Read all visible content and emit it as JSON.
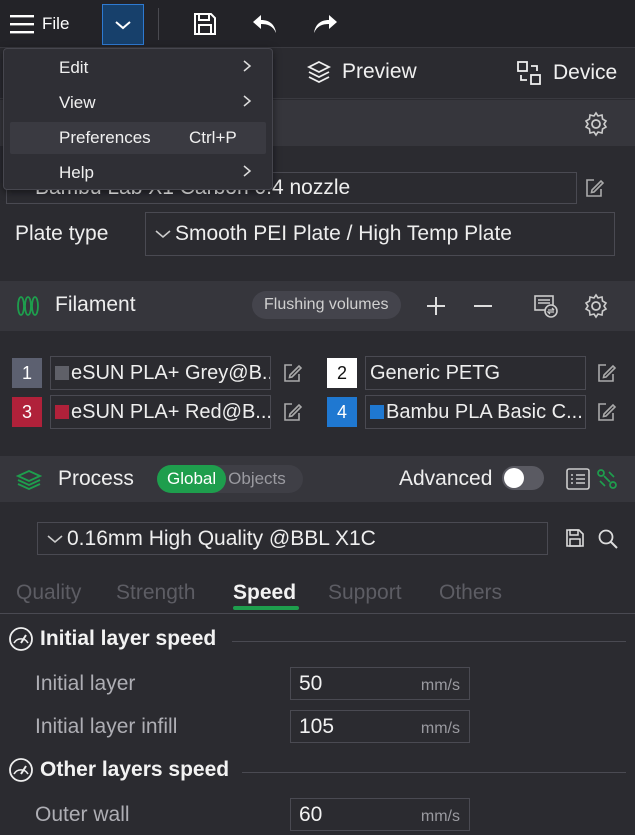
{
  "toolbar": {
    "file_label": "File",
    "icons": [
      "menu-icon",
      "chevron-down-icon",
      "save-icon",
      "undo-icon",
      "redo-icon"
    ]
  },
  "tabs": [
    {
      "label": "Preview",
      "icon": "cube-layers-icon"
    },
    {
      "label": "Device",
      "icon": "device-icon"
    }
  ],
  "menu": {
    "items": [
      {
        "label": "Edit",
        "shortcut": "",
        "has_submenu": true
      },
      {
        "label": "View",
        "shortcut": "",
        "has_submenu": true
      },
      {
        "label": "Preferences",
        "shortcut": "Ctrl+P",
        "has_submenu": false,
        "highlighted": true
      },
      {
        "label": "Help",
        "shortcut": "",
        "has_submenu": true
      }
    ]
  },
  "printer": {
    "selected": "Bambu Lab X1 Carbon 0.4 nozzle",
    "plate_type_label": "Plate type",
    "plate_type_value": "Smooth PEI Plate / High Temp Plate"
  },
  "filament": {
    "title": "Filament",
    "flushing_label": "Flushing volumes",
    "slots": [
      {
        "num": "1",
        "name": "eSUN PLA+ Grey@B...",
        "badge_color": "#5c6070",
        "swatch": "#5f6068"
      },
      {
        "num": "2",
        "name": "Generic PETG",
        "badge_color": "#ffffff",
        "swatch": ""
      },
      {
        "num": "3",
        "name": "eSUN PLA+ Red@B...",
        "badge_color": "#b0213a",
        "swatch": "#b0213a"
      },
      {
        "num": "4",
        "name": "Bambu PLA Basic C...",
        "badge_color": "#1f78d1",
        "swatch": "#1f78d1"
      }
    ]
  },
  "process": {
    "title": "Process",
    "global_label": "Global",
    "objects_label": "Objects",
    "advanced_label": "Advanced",
    "advanced_on": false,
    "preset": "0.16mm High Quality @BBL X1C",
    "subtabs": [
      "Quality",
      "Strength",
      "Speed",
      "Support",
      "Others"
    ],
    "active_subtab": "Speed",
    "groups": [
      {
        "title": "Initial layer speed",
        "rows": [
          {
            "label": "Initial layer",
            "value": "50",
            "unit": "mm/s"
          },
          {
            "label": "Initial layer infill",
            "value": "105",
            "unit": "mm/s"
          }
        ]
      },
      {
        "title": "Other layers speed",
        "rows": [
          {
            "label": "Outer wall",
            "value": "60",
            "unit": "mm/s"
          }
        ]
      }
    ]
  },
  "colors": {
    "accent_green": "#1e9e4d",
    "accent_blue": "#2e7ad1",
    "bg": "#2b2b30"
  }
}
